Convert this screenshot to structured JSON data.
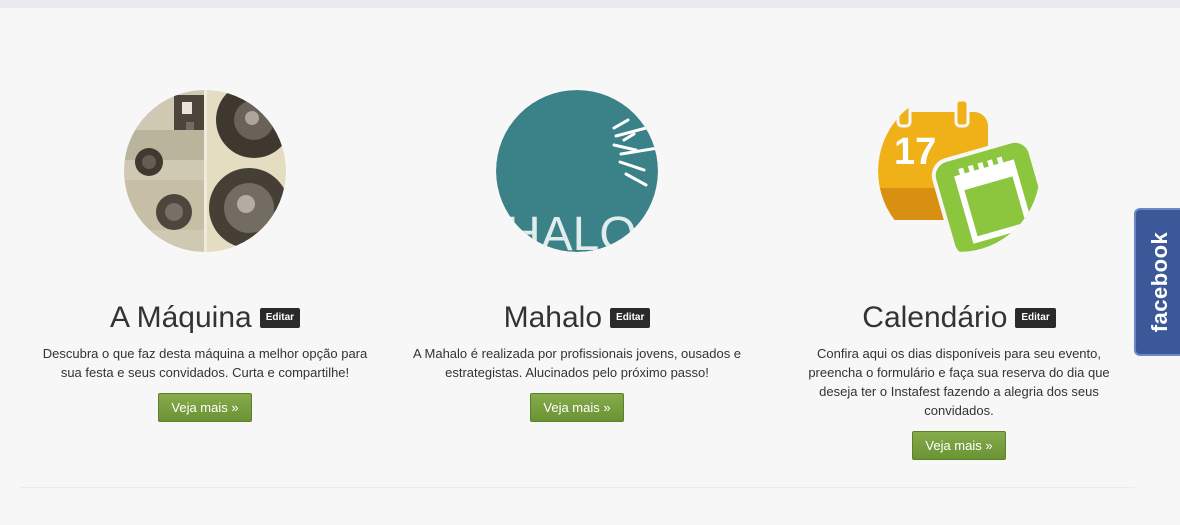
{
  "features": [
    {
      "title": "A Máquina",
      "edit_label": "Editar",
      "description": "Descubra o que faz desta máquina a melhor opção para sua festa e seus convidados. Curta e compartilhe!",
      "cta_label": "Veja mais »",
      "image_icon": "camera-photo-icon"
    },
    {
      "title": "Mahalo",
      "edit_label": "Editar",
      "description": "A Mahalo é realizada por profissionais jovens, ousados e estrategistas. Alucinados pelo próximo passo!",
      "cta_label": "Veja mais »",
      "image_icon": "mahalo-logo-icon",
      "image_text": "HALO"
    },
    {
      "title": "Calendário",
      "edit_label": "Editar",
      "description": "Confira aqui os dias disponíveis para seu evento, preencha o formulário e faça sua reserva do dia que deseja ter o Instafest fazendo a alegria dos seus convidados.",
      "cta_label": "Veja mais »",
      "image_icon": "calendar-icon",
      "image_text": "17"
    }
  ],
  "facebook_tab": {
    "label": "facebook",
    "color": "#3b5998"
  },
  "colors": {
    "button_green": "#77a03f",
    "mahalo_teal": "#3b8188",
    "calendar_orange": "#f0b018",
    "calendar_green": "#8cc63f"
  }
}
